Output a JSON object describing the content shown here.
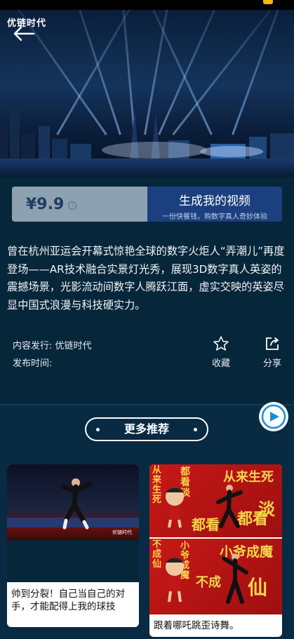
{
  "hero": {
    "logo_text": "优链时代",
    "back_icon": "back-arrow-icon"
  },
  "purchase": {
    "price": "¥9.9",
    "info_icon": "info-icon",
    "generate_title": "生成我的视频",
    "generate_subtitle": "一份快餐钱，购数字真人奇妙体验"
  },
  "description": "曾在杭州亚运会开幕式惊艳全球的数字火炬人“弄潮儿”再度登场——AR技术融合实景灯光秀，展现3D数字真人英姿的震撼场景，光影流动间数字人腾跃江面，虚实交映的英姿尽显中国式浪漫与科技硬实力。",
  "meta": {
    "publisher": "内容发行: 优链时代",
    "publish_time": "发布时间:"
  },
  "actions": {
    "favorite_label": "收藏",
    "favorite_icon": "star-icon",
    "share_label": "分享",
    "share_icon": "share-icon"
  },
  "recommend": {
    "title": "更多推荐",
    "play_icon": "play-icon",
    "cards": [
      {
        "caption": "帅到分裂！自己当自己的对手，才能配得上我的球技",
        "thumb_watermark": "优链时代"
      },
      {
        "caption": "跟着哪吒跳歪诗舞。",
        "calligraphy_top": [
          "从来生死",
          "都看淡",
          "都看",
          "从来生死",
          "都看",
          "淡"
        ],
        "calligraphy_bottom": [
          "不成仙",
          "小爷成魔",
          "不成",
          "小爷成魔",
          "仙"
        ]
      }
    ]
  },
  "colors": {
    "background": "#06263a",
    "price_box": "#8ea1b1",
    "generate_button": "#1b3f7f",
    "panel_red": "#c81818",
    "calligraphy_gold": "#f6d44a"
  }
}
